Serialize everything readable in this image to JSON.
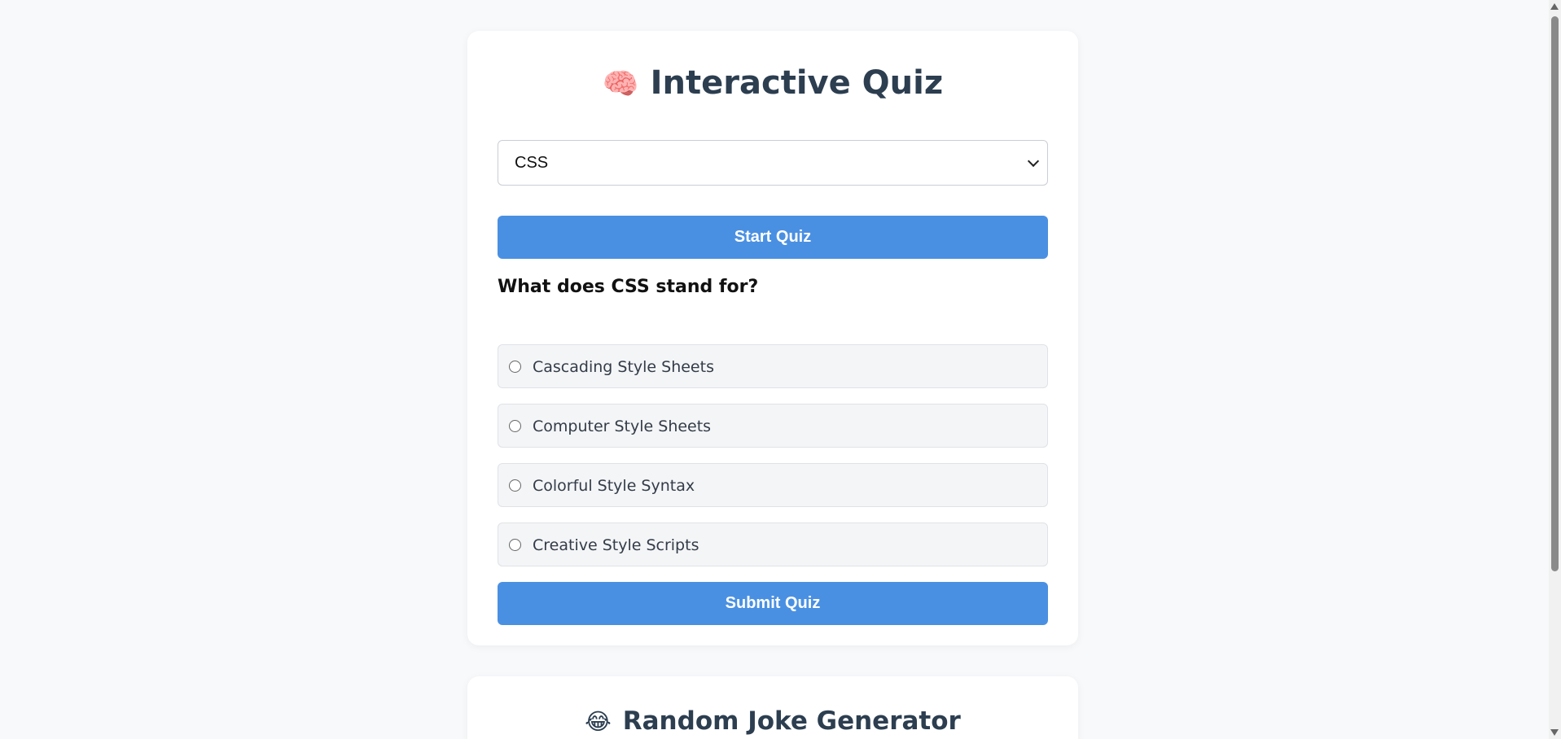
{
  "quiz": {
    "icon": "brain-icon",
    "emoji": "🧠",
    "title": "Interactive Quiz",
    "category_select": {
      "selected": "CSS"
    },
    "start_label": "Start Quiz",
    "question": "What does CSS stand for?",
    "options": [
      "Cascading Style Sheets",
      "Computer Style Sheets",
      "Colorful Style Syntax",
      "Creative Style Scripts"
    ],
    "submit_label": "Submit Quiz"
  },
  "joke": {
    "icon": "laughing-face-icon",
    "emoji": "😂",
    "title": "Random Joke Generator"
  },
  "colors": {
    "accent": "#4a90e2",
    "background": "#f7f9fb",
    "card": "#ffffff",
    "heading": "#2c3e50"
  }
}
